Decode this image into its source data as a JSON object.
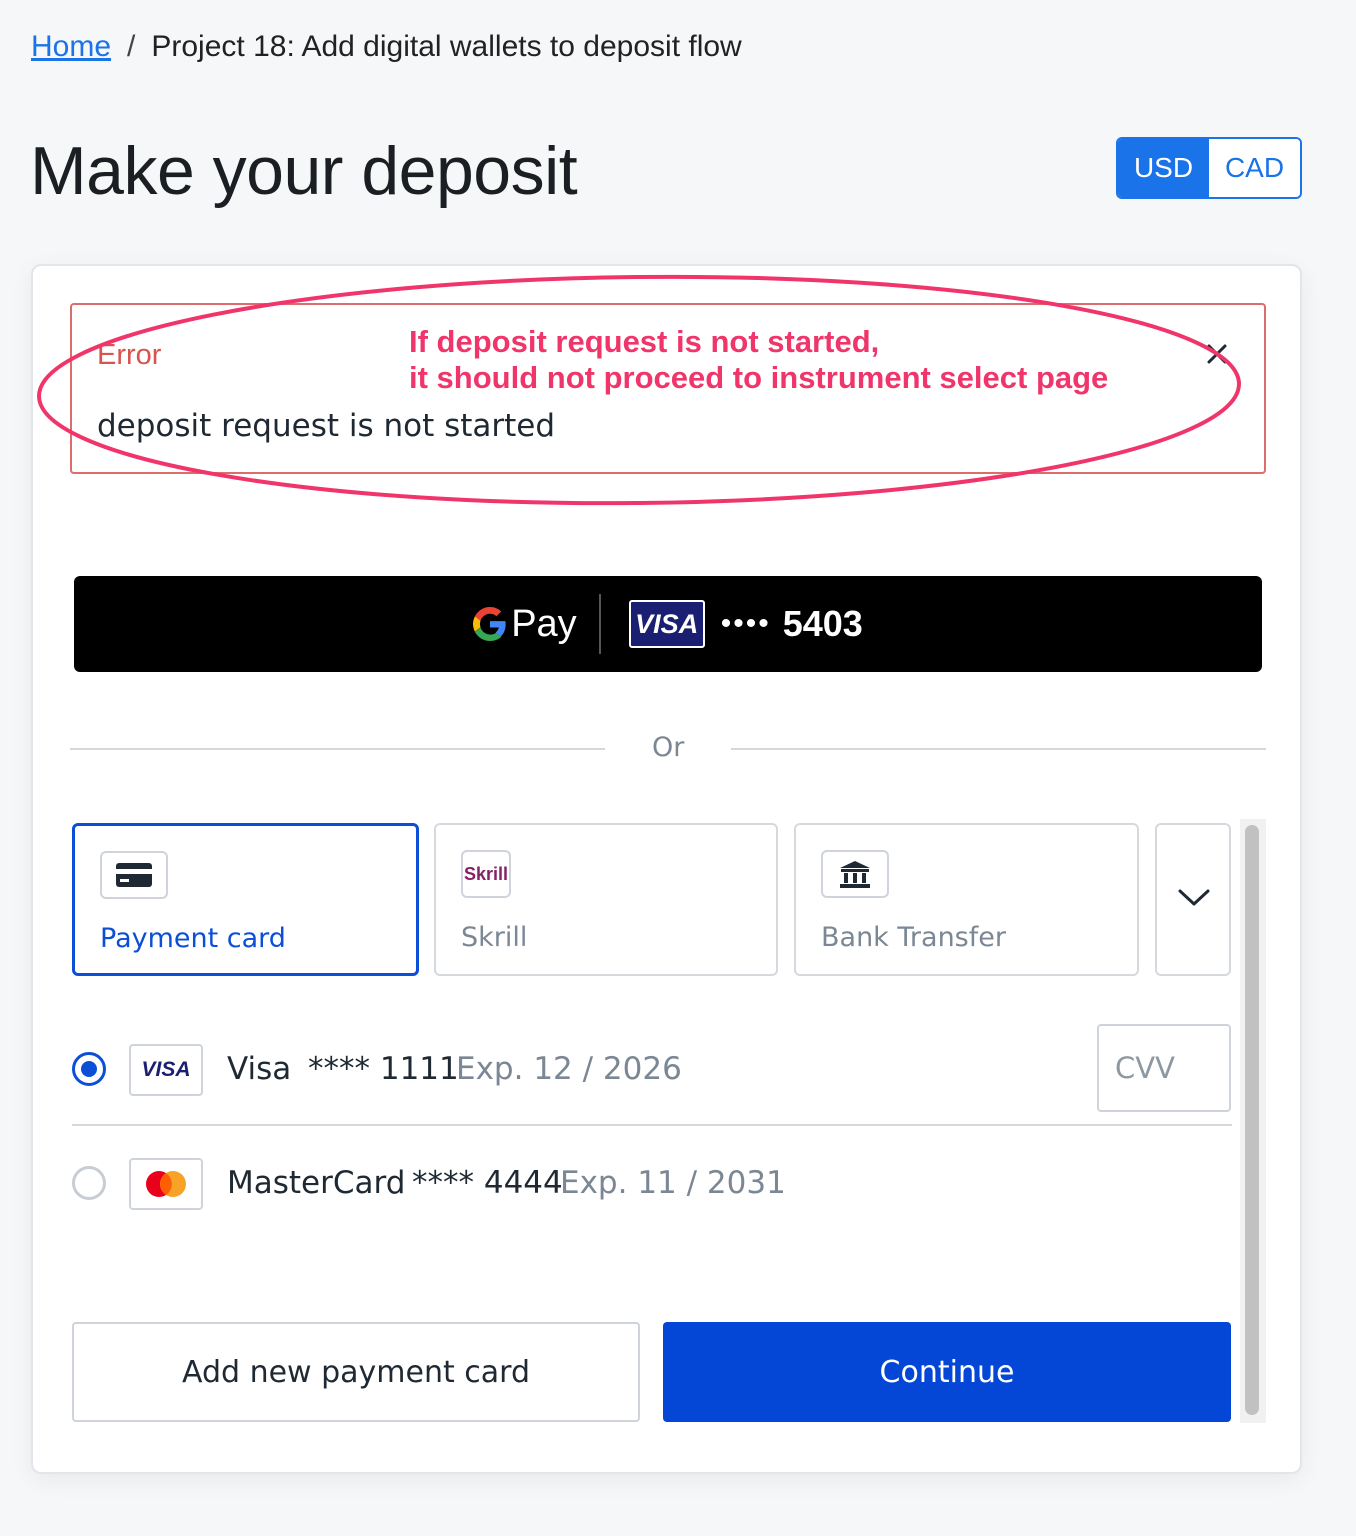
{
  "breadcrumb": {
    "home": "Home",
    "separator": "/",
    "current": "Project 18: Add digital wallets to deposit flow"
  },
  "page": {
    "title": "Make your deposit"
  },
  "currency": {
    "options": [
      "USD",
      "CAD"
    ],
    "selected": "USD"
  },
  "alert": {
    "title": "Error",
    "message": "deposit request is not started",
    "close_icon": "close-icon"
  },
  "annotation": {
    "line1": "If deposit request is not started,",
    "line2": "it should not proceed to instrument select page",
    "color": "#f0356b"
  },
  "gpay": {
    "pay_label": "Pay",
    "card_brand": "VISA",
    "dots": "••••",
    "last4": "5403"
  },
  "divider": {
    "or_label": "Or"
  },
  "methods": [
    {
      "label": "Payment card",
      "icon": "credit-card-icon",
      "active": true
    },
    {
      "label": "Skrill",
      "icon": "skrill-logo",
      "logo_text": "Skrill",
      "active": false
    },
    {
      "label": "Bank Transfer",
      "icon": "bank-icon",
      "active": false
    }
  ],
  "saved_cards": [
    {
      "brand": "Visa",
      "badge": "VISA",
      "mask": "**** 1111",
      "exp": "Exp. 12 / 2026",
      "selected": true
    },
    {
      "brand": "MasterCard",
      "badge": "mastercard-logo",
      "mask": "**** 4444",
      "exp": "Exp. 11 / 2031",
      "selected": false
    }
  ],
  "cvv": {
    "placeholder": "CVV"
  },
  "actions": {
    "add_card": "Add new payment card",
    "continue": "Continue"
  },
  "colors": {
    "primary": "#0447d6",
    "link": "#1a73e8",
    "error": "#d9534f"
  }
}
